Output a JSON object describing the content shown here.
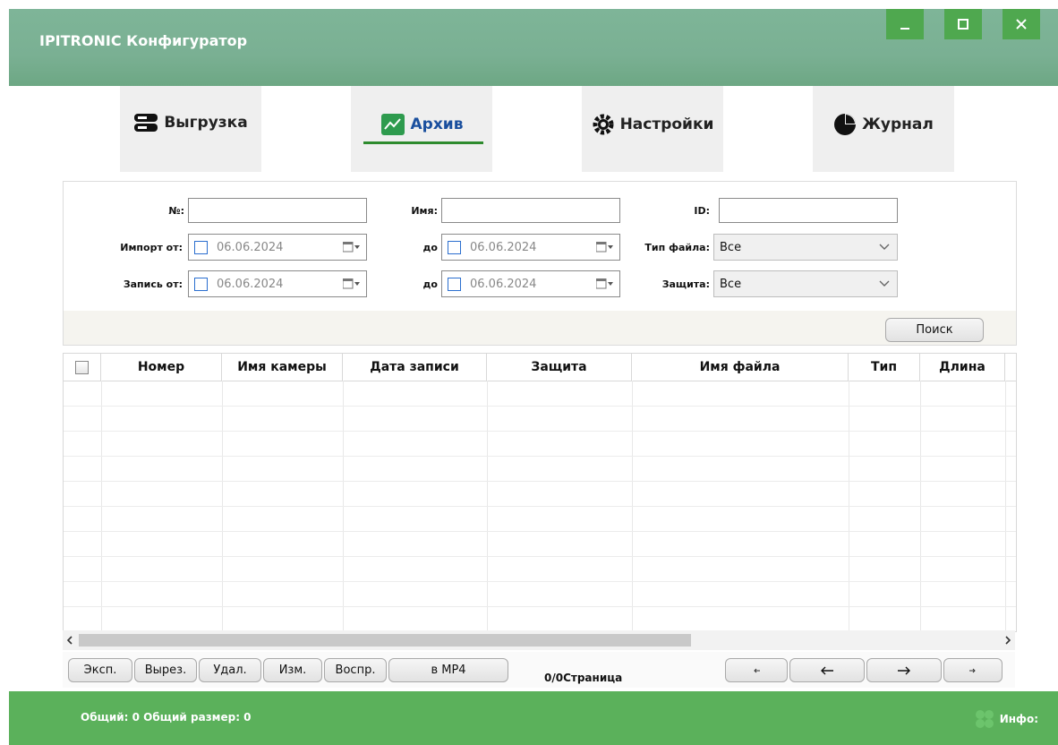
{
  "window": {
    "title": "IPITRONIC Конфигуратор",
    "colors": {
      "titlebar": "#7eb598",
      "accent_green": "#4fa84f",
      "status_green": "#5bb15b",
      "tab_active": "#1a4f9e"
    }
  },
  "tabs": [
    {
      "label": "Выгрузка",
      "icon": "server-icon",
      "active": false
    },
    {
      "label": "Архив",
      "icon": "chart-icon",
      "active": true
    },
    {
      "label": "Настройки",
      "icon": "gear-icon",
      "active": false
    },
    {
      "label": "Журнал",
      "icon": "pie-icon",
      "active": false
    }
  ],
  "filters": {
    "number_label": "№:",
    "name_label": "Имя:",
    "id_label": "ID:",
    "import_from_label": "Импорт от:",
    "import_to_label": "до",
    "record_from_label": "Запись от:",
    "record_to_label": "до",
    "import_from": "06.06.2024",
    "import_to": "06.06.2024",
    "record_from": "06.06.2024",
    "record_to": "06.06.2024",
    "filetype_label": "Тип файла:",
    "filetype_value": "Все",
    "protection_label": "Защита:",
    "protection_value": "Все",
    "search_button": "Поиск"
  },
  "table": {
    "columns": [
      "Номер",
      "Имя камеры",
      "Дата записи",
      "Защита",
      "Имя файла",
      "Тип",
      "Длина"
    ],
    "rows": []
  },
  "actions": {
    "export": "Эксп.",
    "cut": "Вырез.",
    "delete": "Удал.",
    "edit": "Изм.",
    "play": "Воспр.",
    "to_mp4": "в MP4"
  },
  "pager": {
    "text": "0/0Страница"
  },
  "status": {
    "left": "Общий: 0 Общий размер: 0",
    "info_label": "Инфо:"
  }
}
